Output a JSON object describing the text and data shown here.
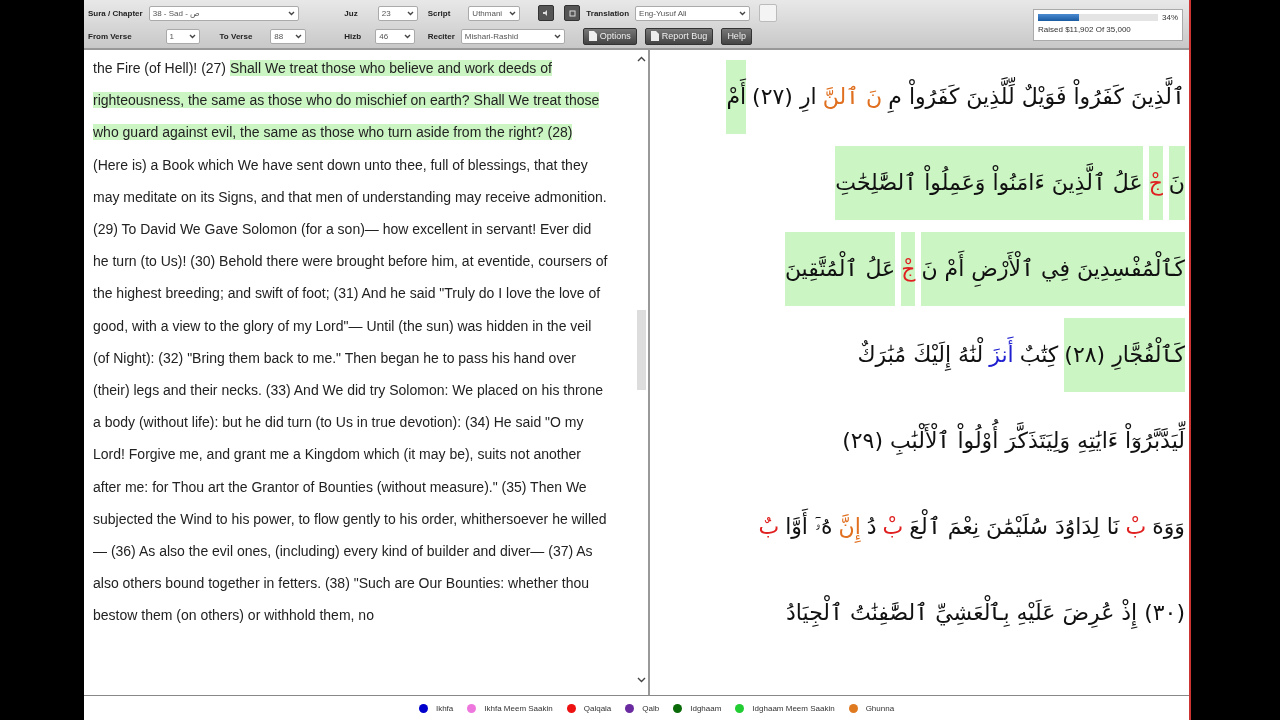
{
  "toolbar": {
    "sura": {
      "label": "Sura / Chapter",
      "value": "38 - Sad - ص"
    },
    "from_verse": {
      "label": "From Verse",
      "value": "1"
    },
    "to_verse": {
      "label": "To Verse",
      "value": "88"
    },
    "juz": {
      "label": "Juz",
      "value": "23"
    },
    "hizb": {
      "label": "Hizb",
      "value": "46"
    },
    "script": {
      "label": "Script",
      "value": "Uthmani"
    },
    "reciter": {
      "label": "Reciter",
      "value": "Mishari-Rashid"
    },
    "translation": {
      "label": "Translation",
      "value": "Eng-Yusuf Ali"
    },
    "buttons": [
      "Options",
      "Report Bug",
      "Help"
    ]
  },
  "donation": {
    "level": 0.34,
    "percent": "34%",
    "raised": "Raised $11,902 Of 35,000"
  },
  "translation_panel": {
    "segments": [
      {
        "text": "the Fire (of Hell)! (27) ",
        "highlighted": false
      },
      {
        "text": "Shall We treat those who believe and work deeds of righteousness, the same as those who do mischief on earth? Shall We treat those who guard against evil, the same as those who turn aside from the right? (28)",
        "highlighted": true
      },
      {
        "text": " (Here is) a Book which We have sent down unto thee, full of blessings, that they may meditate on its Signs, and that men of understanding may receive admonition. (29) To David We Gave Solomon (for a son)— how excellent in servant! Ever did he turn (to Us)! (30) Behold there were brought before him, at eventide, coursers of the highest breeding; and swift of foot; (31) And he said \"Truly do I love the love of good, with a view to the glory of my Lord\"— Until (the sun) was hidden in the veil (of Night): (32) \"Bring them back to me.\" Then began he to pass his hand over (their) legs and their necks. (33) And We did try Solomon: We placed on his throne a body (without life): but he did turn (to Us in true devotion): (34) He said \"O my Lord! Forgive me, and grant me a Kingdom which (it may be), suits not another after me: for Thou art the Grantor of Bounties (without measure).\" (35) Then We subjected the Wind to his power, to flow gently to his order, whithersoever he willed— (36) As also the evil ones, (including) every kind of builder and diver— (37) As also others bound together in fetters. (38) \"Such are Our Bounties: whether thou bestow them (on others) or withhold them, no",
        "highlighted": false
      }
    ]
  },
  "arabic_panel": {
    "lines": [
      [
        {
          "text": "ٱلَّذِينَ كَفَرُواْ فَوَيْلٌ لِّلَّذِينَ كَفَرُواْ مِ",
          "highlighted": false
        },
        {
          "text": "نَ ٱلنَّ",
          "highlighted": false,
          "color": "#e07020"
        },
        {
          "text": "ارِ (٢٧)",
          "highlighted": false
        },
        {
          "text": "أَمْ",
          "highlighted": true
        }
      ],
      [
        {
          "text": "نَ",
          "highlighted": true
        },
        {
          "text": "جْ",
          "highlighted": true,
          "color": "#e02020"
        },
        {
          "text": "عَلُ ٱلَّذِينَ ءَامَنُواْ وَعَمِلُواْ ٱلصَّٰلِحَٰتِ",
          "highlighted": true
        }
      ],
      [
        {
          "text": "كَٱلْمُفْسِدِينَ فِي ٱلْأَرْضِ أَمْ نَ",
          "highlighted": true
        },
        {
          "text": "جْ",
          "highlighted": true,
          "color": "#e02020"
        },
        {
          "text": "عَلُ ٱلْمُتَّقِينَ",
          "highlighted": true
        }
      ],
      [
        {
          "text": "كَٱلْفُجَّارِ (٢٨)",
          "highlighted": true
        },
        {
          "text": "كِتَٰبٌ",
          "highlighted": false
        },
        {
          "text": "أَنزَ",
          "highlighted": false,
          "color": "#2020d0"
        },
        {
          "text": "لْنَٰهُ إِلَيْكَ مُبَٰرَكٌ",
          "highlighted": false
        }
      ],
      [
        {
          "text": "لِّيَدَّبَّرُوٓاْ ءَايَٰتِهِ وَلِيَتَذَكَّرَ أُوْلُواْ ٱلْأَلْبَٰبِ (٢٩)",
          "highlighted": false
        }
      ],
      [
        {
          "text": "وَوَهَ",
          "highlighted": false
        },
        {
          "text": "بْ",
          "highlighted": false,
          "color": "#e02020"
        },
        {
          "text": "نَا لِدَاوُدَ سُلَيْمَٰنَ نِعْمَ ٱلْعَ",
          "highlighted": false
        },
        {
          "text": "بْ",
          "highlighted": false,
          "color": "#e02020"
        },
        {
          "text": "دُ",
          "highlighted": false
        },
        {
          "text": "إِنَّ",
          "highlighted": false,
          "color": "#e07020"
        },
        {
          "text": "هُۥٓ أَوَّا",
          "highlighted": false
        },
        {
          "text": "بٌ",
          "highlighted": false,
          "color": "#e02020"
        }
      ],
      [
        {
          "text": "(٣٠) إِذْ عُرِضَ عَلَيْهِ بِٱلْعَشِيِّ ٱلصَّٰفِنَٰتُ ٱلْجِيَادُ",
          "highlighted": false
        }
      ]
    ]
  },
  "legend": [
    {
      "label": "Ikhfa",
      "color": "#0000cc"
    },
    {
      "label": "Ikhfa Meem Saakin",
      "color": "#ee77dd"
    },
    {
      "label": "Qalqala",
      "color": "#ee1111"
    },
    {
      "label": "Qalb",
      "color": "#6a2aa0"
    },
    {
      "label": "Idghaam",
      "color": "#0a6a0a"
    },
    {
      "label": "Idghaam Meem Saakin",
      "color": "#22cc33"
    },
    {
      "label": "Ghunna",
      "color": "#e07a20"
    }
  ]
}
